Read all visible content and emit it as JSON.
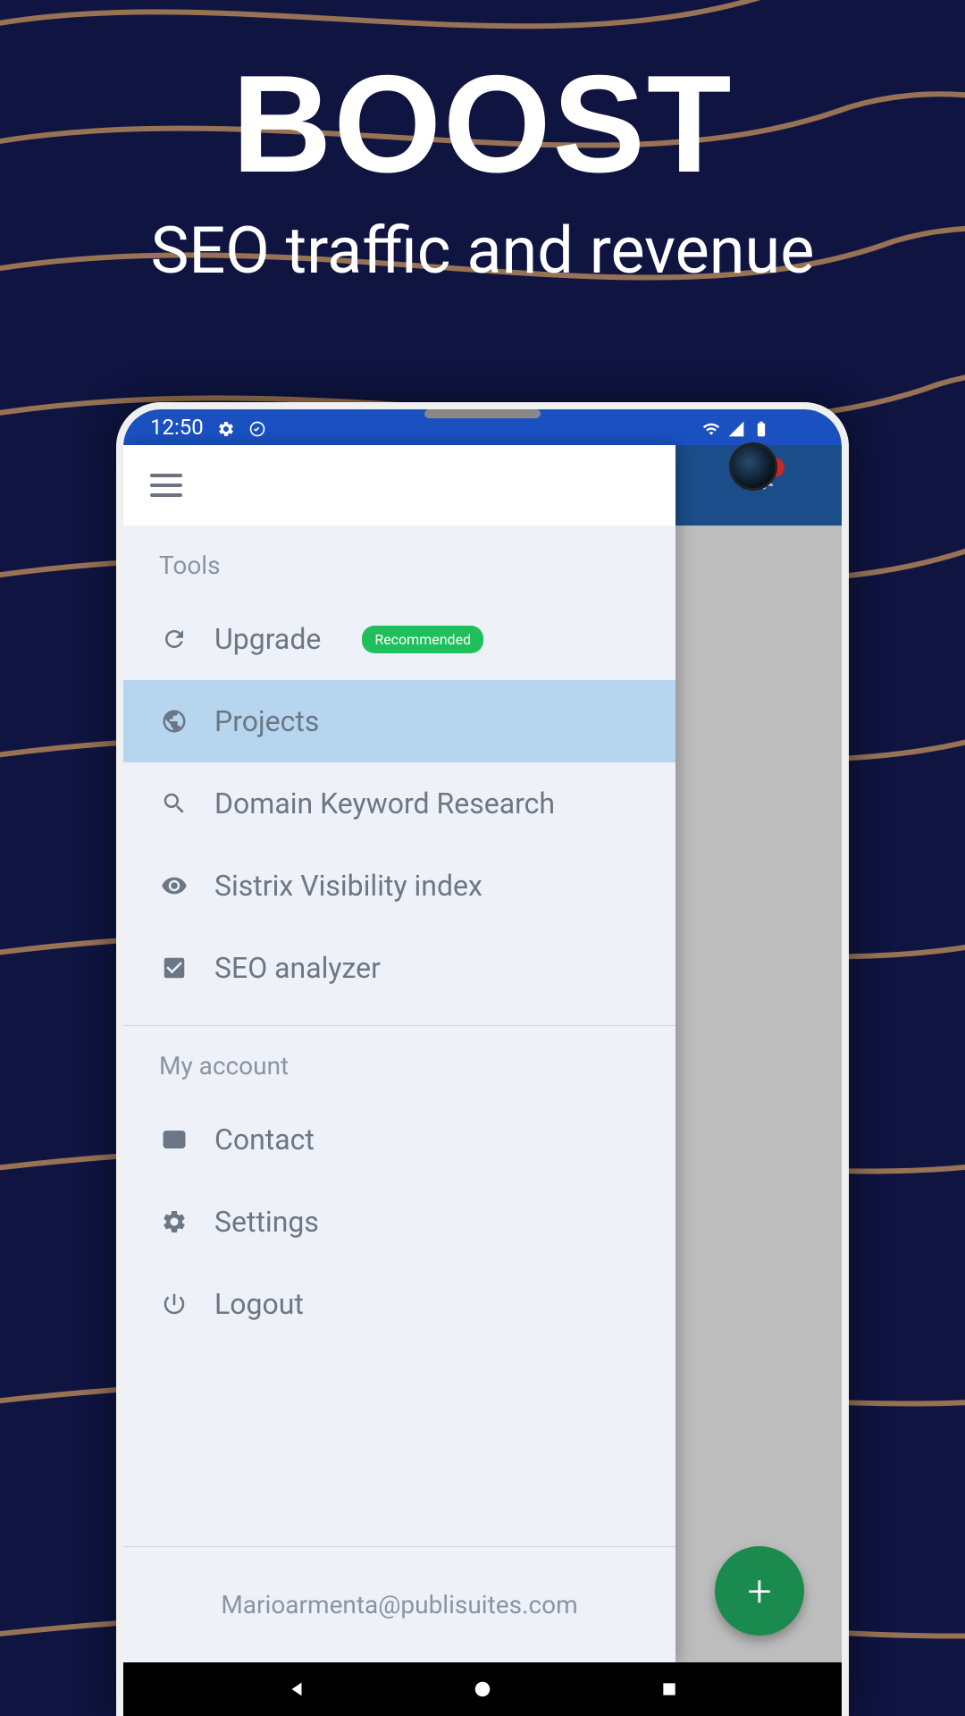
{
  "hero": {
    "title": "BOOST",
    "subtitle": "SEO traffic and revenue"
  },
  "statusbar": {
    "time": "12:50"
  },
  "drawer": {
    "sections": [
      {
        "label": "Tools",
        "items": [
          {
            "icon": "refresh-icon",
            "label": "Upgrade",
            "badge": "Recommended",
            "active": false
          },
          {
            "icon": "globe-icon",
            "label": "Projects",
            "badge": null,
            "active": true
          },
          {
            "icon": "search-icon",
            "label": "Domain Keyword Research",
            "badge": null,
            "active": false
          },
          {
            "icon": "eye-icon",
            "label": "Sistrix Visibility index",
            "badge": null,
            "active": false
          },
          {
            "icon": "check-box-icon",
            "label": "SEO analyzer",
            "badge": null,
            "active": false
          }
        ]
      },
      {
        "label": "My account",
        "items": [
          {
            "icon": "envelope-icon",
            "label": "Contact",
            "badge": null,
            "active": false
          },
          {
            "icon": "gear-icon",
            "label": "Settings",
            "badge": null,
            "active": false
          },
          {
            "icon": "power-icon",
            "label": "Logout",
            "badge": null,
            "active": false
          }
        ]
      }
    ],
    "footer_email": "Marioarmenta@publisuites.com"
  },
  "fab": {
    "label": "+"
  }
}
